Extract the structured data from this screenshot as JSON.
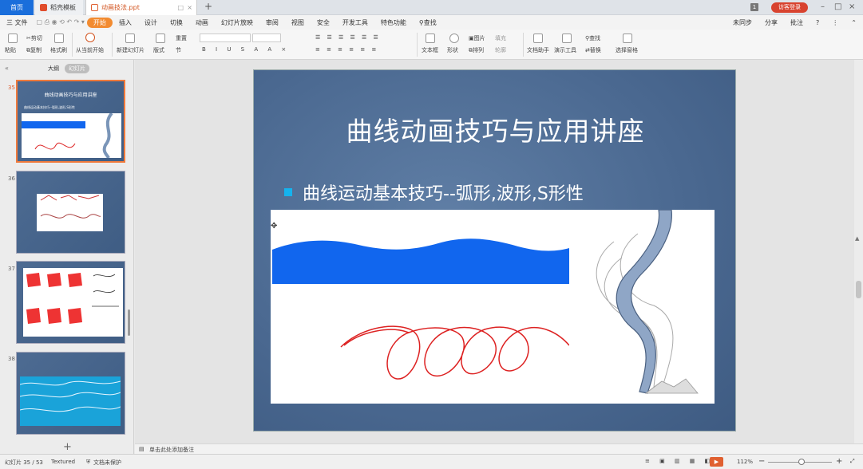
{
  "titlebar": {
    "tabs": [
      {
        "label": "首页"
      },
      {
        "label": "稻壳模板"
      },
      {
        "label": "动画技法.ppt"
      }
    ],
    "page_badge": "1",
    "login_label": "访客登录"
  },
  "menu": {
    "file_label": "三 文件",
    "items": [
      "开始",
      "插入",
      "设计",
      "切换",
      "动画",
      "幻灯片放映",
      "审阅",
      "视图",
      "安全",
      "开发工具",
      "特色功能"
    ],
    "search_label": "查找",
    "right": [
      "未同步",
      "分享",
      "批注"
    ]
  },
  "ribbon": {
    "clipboard": [
      "剪切",
      "复制",
      "格式刷",
      "粘贴"
    ],
    "from_current": "从当前开始",
    "new_slide": "新建幻灯片",
    "layout": "版式",
    "reset": "重置",
    "section": "节",
    "textbox": "文本框",
    "shape": "形状",
    "arrange": "排列",
    "picture": "图片",
    "fill": "填充",
    "outline": "轮廓",
    "text_tool": "文档助手",
    "present_tool": "演示工具",
    "find": "查找",
    "replace": "替换",
    "select_pane": "选择窗格"
  },
  "leftpanel": {
    "tab_outline": "大纲",
    "tab_slides": "幻灯片",
    "slides": [
      {
        "num": "35",
        "title": "曲线动画技巧与应用讲座",
        "bullet": "曲线运动基本技巧--弧形,波形,S形性"
      },
      {
        "num": "36"
      },
      {
        "num": "37"
      },
      {
        "num": "38"
      }
    ],
    "add_label": "+"
  },
  "slide": {
    "title": "曲线动画技巧与应用讲座",
    "bullet": "曲线运动基本技巧--弧形,波形,S形性"
  },
  "notes": {
    "placeholder": "单击此处添加备注"
  },
  "status": {
    "slide_counter": "幻灯片 35 / 53",
    "theme": "Textured",
    "doc_protect": "文档未保护",
    "zoom": "112%"
  },
  "colors": {
    "accent_orange": "#f28b30",
    "home_tab_blue": "#1a6edb",
    "slide_bg": "#4a6890",
    "wave_blue": "#1166ee",
    "curl_red": "#dd2222"
  }
}
